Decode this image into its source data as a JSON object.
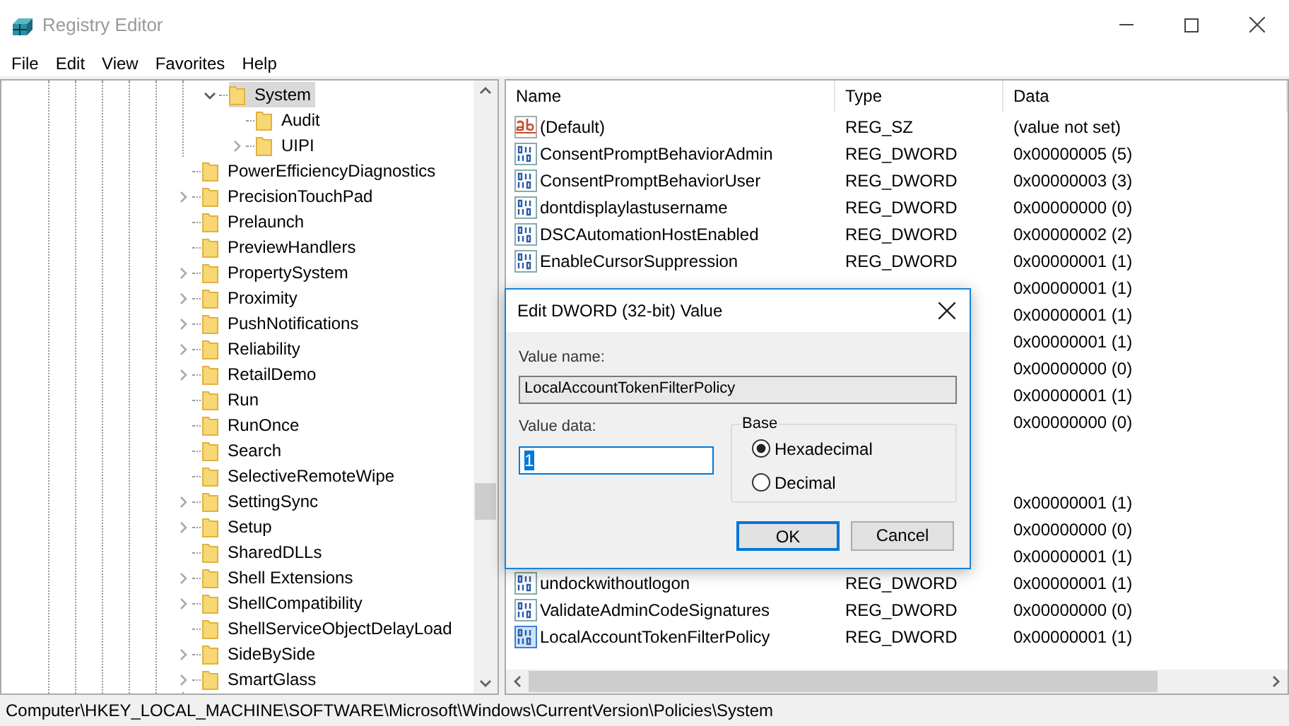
{
  "window": {
    "title": "Registry Editor"
  },
  "menu": [
    "File",
    "Edit",
    "View",
    "Favorites",
    "Help"
  ],
  "tree": {
    "items": [
      {
        "children": [
          {
            "label": "System",
            "kind": "branch",
            "expanded": true,
            "selected": true,
            "children": [
              {
                "label": "Audit",
                "kind": "leaf",
                "selected": false
              },
              {
                "label": "UIPI",
                "kind": "branch",
                "expanded": false,
                "selected": false
              }
            ]
          }
        ]
      },
      {
        "label": "PowerEfficiencyDiagnostics",
        "kind": "leaf",
        "selected": false
      },
      {
        "label": "PrecisionTouchPad",
        "kind": "branch",
        "expanded": false,
        "selected": false
      },
      {
        "label": "Prelaunch",
        "kind": "leaf",
        "selected": false
      },
      {
        "label": "PreviewHandlers",
        "kind": "leaf",
        "selected": false
      },
      {
        "label": "PropertySystem",
        "kind": "branch",
        "expanded": false,
        "selected": false
      },
      {
        "label": "Proximity",
        "kind": "branch",
        "expanded": false,
        "selected": false
      },
      {
        "label": "PushNotifications",
        "kind": "branch",
        "expanded": false,
        "selected": false
      },
      {
        "label": "Reliability",
        "kind": "branch",
        "expanded": false,
        "selected": false
      },
      {
        "label": "RetailDemo",
        "kind": "branch",
        "expanded": false,
        "selected": false
      },
      {
        "label": "Run",
        "kind": "leaf",
        "selected": false
      },
      {
        "label": "RunOnce",
        "kind": "leaf",
        "selected": false
      },
      {
        "label": "Search",
        "kind": "leaf",
        "selected": false
      },
      {
        "label": "SelectiveRemoteWipe",
        "kind": "leaf",
        "selected": false
      },
      {
        "label": "SettingSync",
        "kind": "branch",
        "expanded": false,
        "selected": false
      },
      {
        "label": "Setup",
        "kind": "branch",
        "expanded": false,
        "selected": false
      },
      {
        "label": "SharedDLLs",
        "kind": "leaf",
        "selected": false
      },
      {
        "label": "Shell Extensions",
        "kind": "branch",
        "expanded": false,
        "selected": false
      },
      {
        "label": "ShellCompatibility",
        "kind": "branch",
        "expanded": false,
        "selected": false
      },
      {
        "label": "ShellServiceObjectDelayLoad",
        "kind": "leaf",
        "selected": false
      },
      {
        "label": "SideBySide",
        "kind": "branch",
        "expanded": false,
        "selected": false
      },
      {
        "label": "SmartGlass",
        "kind": "branch",
        "expanded": false,
        "selected": false
      }
    ]
  },
  "values": {
    "columns": [
      "Name",
      "Type",
      "Data"
    ],
    "rows": [
      {
        "kind": "string",
        "selected": false,
        "name": "(Default)",
        "type": "REG_SZ",
        "data": "(value not set)"
      },
      {
        "kind": "dword",
        "selected": false,
        "name": "ConsentPromptBehaviorAdmin",
        "type": "REG_DWORD",
        "data": "0x00000005 (5)"
      },
      {
        "kind": "dword",
        "selected": false,
        "name": "ConsentPromptBehaviorUser",
        "type": "REG_DWORD",
        "data": "0x00000003 (3)"
      },
      {
        "kind": "dword",
        "selected": false,
        "name": "dontdisplaylastusername",
        "type": "REG_DWORD",
        "data": "0x00000000 (0)"
      },
      {
        "kind": "dword",
        "selected": false,
        "name": "DSCAutomationHostEnabled",
        "type": "REG_DWORD",
        "data": "0x00000002 (2)"
      },
      {
        "kind": "dword",
        "selected": false,
        "name": "EnableCursorSuppression",
        "type": "REG_DWORD",
        "data": "0x00000001 (1)"
      },
      {
        "data": "0x00000001 (1)"
      },
      {
        "data": "0x00000001 (1)"
      },
      {
        "data": "0x00000001 (1)"
      },
      {
        "data": "0x00000000 (0)"
      },
      {
        "data": "0x00000001 (1)"
      },
      {
        "data": "0x00000000 (0)"
      },
      {},
      {},
      {
        "data": "0x00000001 (1)"
      },
      {
        "data": "0x00000000 (0)"
      },
      {
        "data": "0x00000001 (1)"
      },
      {
        "kind": "dword",
        "selected": false,
        "name": "undockwithoutlogon",
        "type": "REG_DWORD",
        "data": "0x00000001 (1)"
      },
      {
        "kind": "dword",
        "selected": false,
        "name": "ValidateAdminCodeSignatures",
        "type": "REG_DWORD",
        "data": "0x00000000 (0)"
      },
      {
        "kind": "dword",
        "selected": true,
        "name": "LocalAccountTokenFilterPolicy",
        "type": "REG_DWORD",
        "data": "0x00000001 (1)"
      }
    ]
  },
  "dialog": {
    "title": "Edit DWORD (32-bit) Value",
    "value_name_label": "Value name:",
    "value_name": "LocalAccountTokenFilterPolicy",
    "value_data_label": "Value data:",
    "value_data": "1",
    "base_label": "Base",
    "base_options": [
      {
        "label": "Hexadecimal",
        "selected": true
      },
      {
        "label": "Decimal",
        "selected": false
      }
    ],
    "buttons": [
      {
        "label": "OK",
        "default": true
      },
      {
        "label": "Cancel",
        "default": false
      }
    ]
  },
  "status_bar": "Computer\\HKEY_LOCAL_MACHINE\\SOFTWARE\\Microsoft\\Windows\\CurrentVersion\\Policies\\System"
}
